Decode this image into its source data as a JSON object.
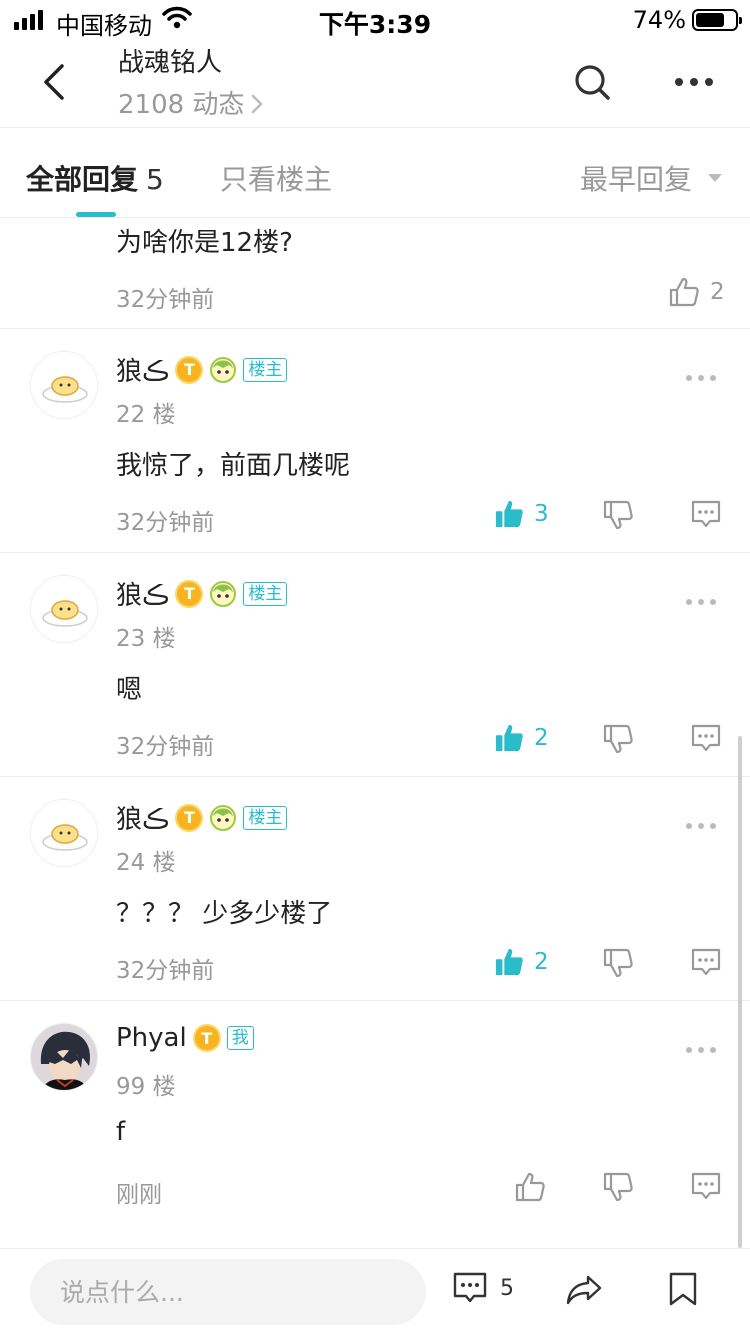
{
  "status_bar": {
    "carrier": "中国移动",
    "time": "下午3:39",
    "battery": "74%",
    "battery_level": 0.74
  },
  "header": {
    "title": "战魂铭人",
    "subtitle": "2108 动态"
  },
  "tabs": {
    "all_label": "全部回复",
    "all_count": "5",
    "owner_label": "只看楼主",
    "sort_label": "最早回复"
  },
  "posts": [
    {
      "content": "为啥你是12楼?",
      "time": "32分钟前",
      "likes": "2"
    },
    {
      "name": "狼ڪ",
      "floor": "22 楼",
      "content": "我惊了，前面几楼呢",
      "time": "32分钟前",
      "likes": "3",
      "owner_badge": "楼主",
      "t_badge": "T"
    },
    {
      "name": "狼ڪ",
      "floor": "23 楼",
      "content": "嗯",
      "time": "32分钟前",
      "likes": "2",
      "owner_badge": "楼主",
      "t_badge": "T"
    },
    {
      "name": "狼ڪ",
      "floor": "24 楼",
      "content": "？？？ 少多少楼了",
      "time": "32分钟前",
      "likes": "2",
      "owner_badge": "楼主",
      "t_badge": "T"
    },
    {
      "name": "Phyal",
      "floor": "99 楼",
      "content": "f",
      "time": "刚刚",
      "me_badge": "我",
      "t_badge": "T"
    }
  ],
  "bottom_bar": {
    "placeholder": "说点什么...",
    "comment_count": "5"
  },
  "colors": {
    "accent": "#2bbcc9",
    "gold": "#f6b520",
    "muted": "#999999"
  },
  "icons": [
    "back-icon",
    "search-icon",
    "more-icon",
    "thumbs-up-icon",
    "thumbs-down-icon",
    "comment-icon",
    "share-icon",
    "bookmark-icon"
  ]
}
